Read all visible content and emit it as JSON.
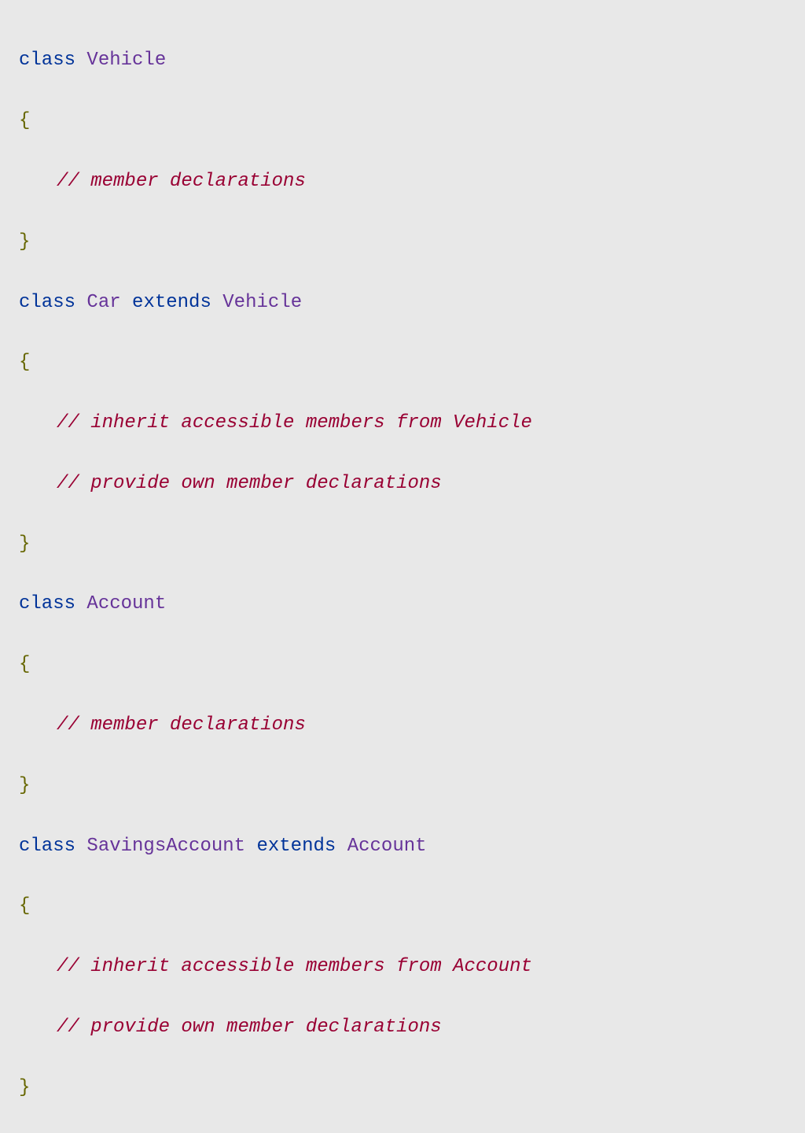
{
  "code": {
    "class1": {
      "keyword_class": "class",
      "name": "Vehicle",
      "open_brace": "{",
      "comment1": "// member declarations",
      "close_brace": "}"
    },
    "class2": {
      "keyword_class": "class",
      "name": "Car",
      "keyword_extends": "extends",
      "parent": "Vehicle",
      "open_brace": "{",
      "comment1": "// inherit accessible members from Vehicle",
      "comment2": "// provide own member declarations",
      "close_brace": "}"
    },
    "class3": {
      "keyword_class": "class",
      "name": "Account",
      "open_brace": "{",
      "comment1": "// member declarations",
      "close_brace": "}"
    },
    "class4": {
      "keyword_class": "class",
      "name": "SavingsAccount",
      "keyword_extends": "extends",
      "parent": "Account",
      "open_brace": "{",
      "comment1": "// inherit accessible members from Account",
      "comment2": "// provide own member declarations",
      "close_brace": "}"
    }
  }
}
